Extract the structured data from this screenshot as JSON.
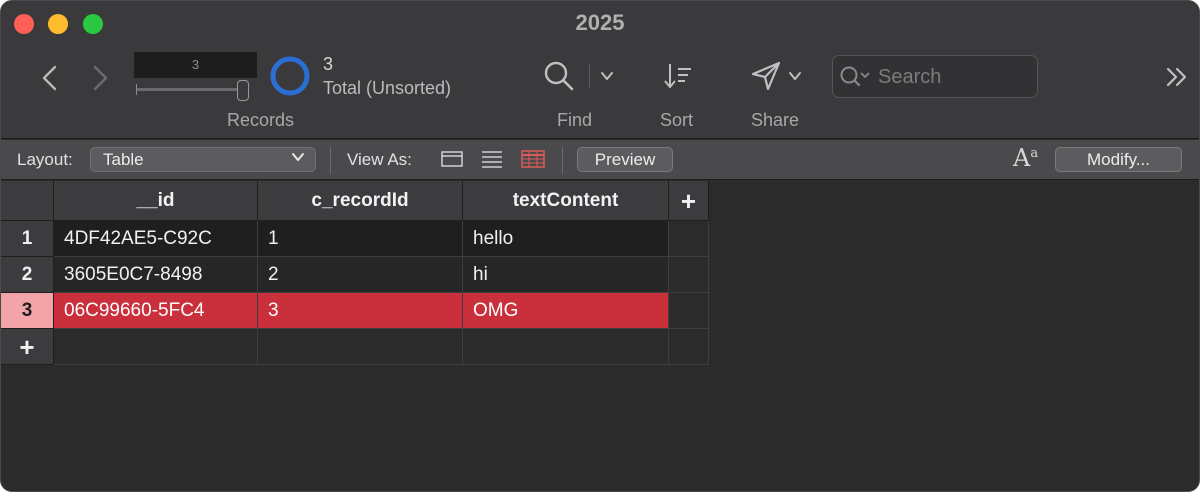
{
  "window": {
    "title": "2025"
  },
  "toolbar": {
    "record_field_value": "3",
    "record_count": "3",
    "record_status": "Total (Unsorted)",
    "records_label": "Records",
    "find_label": "Find",
    "sort_label": "Sort",
    "share_label": "Share",
    "search_placeholder": "Search"
  },
  "layout_bar": {
    "layout_label": "Layout:",
    "layout_value": "Table",
    "view_as_label": "View As:",
    "preview_label": "Preview",
    "modify_label": "Modify...",
    "font_icon": "A",
    "font_icon_sup": "a"
  },
  "table": {
    "columns": [
      "__id",
      "c_recordId",
      "textContent"
    ],
    "add_column_label": "+",
    "add_row_label": "+",
    "rows": [
      {
        "num": "1",
        "cells": [
          "4DF42AE5-C92C",
          "1",
          "hello"
        ]
      },
      {
        "num": "2",
        "cells": [
          "3605E0C7-8498",
          "2",
          "hi"
        ]
      },
      {
        "num": "3",
        "cells": [
          "06C99660-5FC4",
          "3",
          "OMG"
        ]
      }
    ],
    "active_row": 3
  },
  "colors": {
    "active_row_fill": "#c9303c",
    "active_row_num": "#f2a4a8",
    "accent_blue": "#2b6fd6",
    "table_view_icon": "#e05a5a"
  },
  "icons": {
    "back": "chevron-left-icon",
    "forward": "chevron-right-icon",
    "find": "magnifier-icon",
    "sort": "sort-icon",
    "share": "paper-plane-icon",
    "overflow": "double-chevron-right-icon"
  }
}
